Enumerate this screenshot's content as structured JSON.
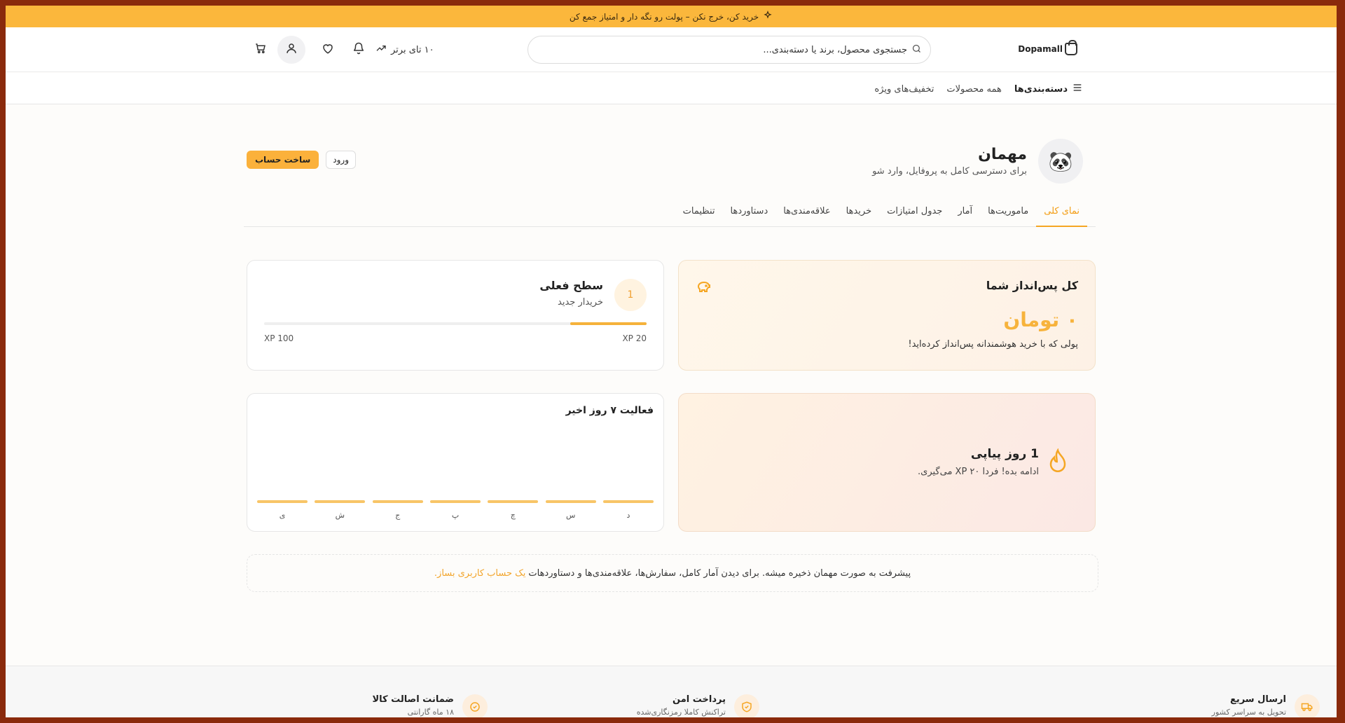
{
  "promo": {
    "text": "خرید کن، خرج نکن – پولت رو نگه دار و امتیاز جمع کن"
  },
  "header": {
    "logo": "Dopamall",
    "search_placeholder": "جستجوی محصول، برند یا دسته‌بندی...",
    "top10": "۱۰ تای برتر"
  },
  "nav": {
    "categories": "دسته‌بندی‌ها",
    "all_products": "همه محصولات",
    "special_offers": "تخفیف‌های ویژه"
  },
  "profile": {
    "name": "مهمان",
    "subtitle": "برای دسترسی کامل به پروفایل، وارد شو",
    "create_account": "ساخت حساب",
    "login": "ورود"
  },
  "tabs": [
    "نمای کلی",
    "ماموریت‌ها",
    "آمار",
    "جدول امتیازات",
    "خریدها",
    "علاقه‌مندی‌ها",
    "دستاوردها",
    "تنظیمات"
  ],
  "savings": {
    "title": "کل پس‌انداز شما",
    "amount": "۰ تومان",
    "note": "پولی که با خرید هوشمندانه پس‌انداز کرده‌اید!"
  },
  "level": {
    "number": "1",
    "title": "سطح فعلی",
    "subtitle": "خریدار جدید",
    "progress": 0.2,
    "xp_current": "XP 20",
    "xp_max": "XP 100"
  },
  "streak": {
    "title": "1 روز پیاپی",
    "subtitle": "ادامه بده! فردا XP ۲۰ می‌گیری."
  },
  "activity": {
    "title": "فعالیت ۷ روز اخیر",
    "days": [
      {
        "label": "د",
        "value": 0
      },
      {
        "label": "س",
        "value": 0
      },
      {
        "label": "چ",
        "value": 0
      },
      {
        "label": "پ",
        "value": 0
      },
      {
        "label": "ج",
        "value": 0
      },
      {
        "label": "ش",
        "value": 0
      },
      {
        "label": "ی",
        "value": 0
      }
    ]
  },
  "notice": {
    "text": "پیشرفت به صورت مهمان ذخیره میشه. برای دیدن آمار کامل، سفارش‌ها، علاقه‌مندی‌ها و دستاوردهات",
    "link": "یک حساب کاربری بساز."
  },
  "footer": {
    "features": [
      {
        "title": "ارسال سریع",
        "sub": "تحویل به سراسر کشور",
        "icon": "truck-icon"
      },
      {
        "title": "پرداخت امن",
        "sub": "تراکنش کاملا رمزنگاری‌شده",
        "icon": "shield-check-icon"
      },
      {
        "title": "ضمانت اصالت کالا",
        "sub": "۱۸ ماه گارانتی",
        "icon": "badge-check-icon"
      }
    ]
  },
  "colors": {
    "accent": "#fbb73c",
    "active_tab": "#f39c12",
    "bar": "#f5b23a"
  }
}
